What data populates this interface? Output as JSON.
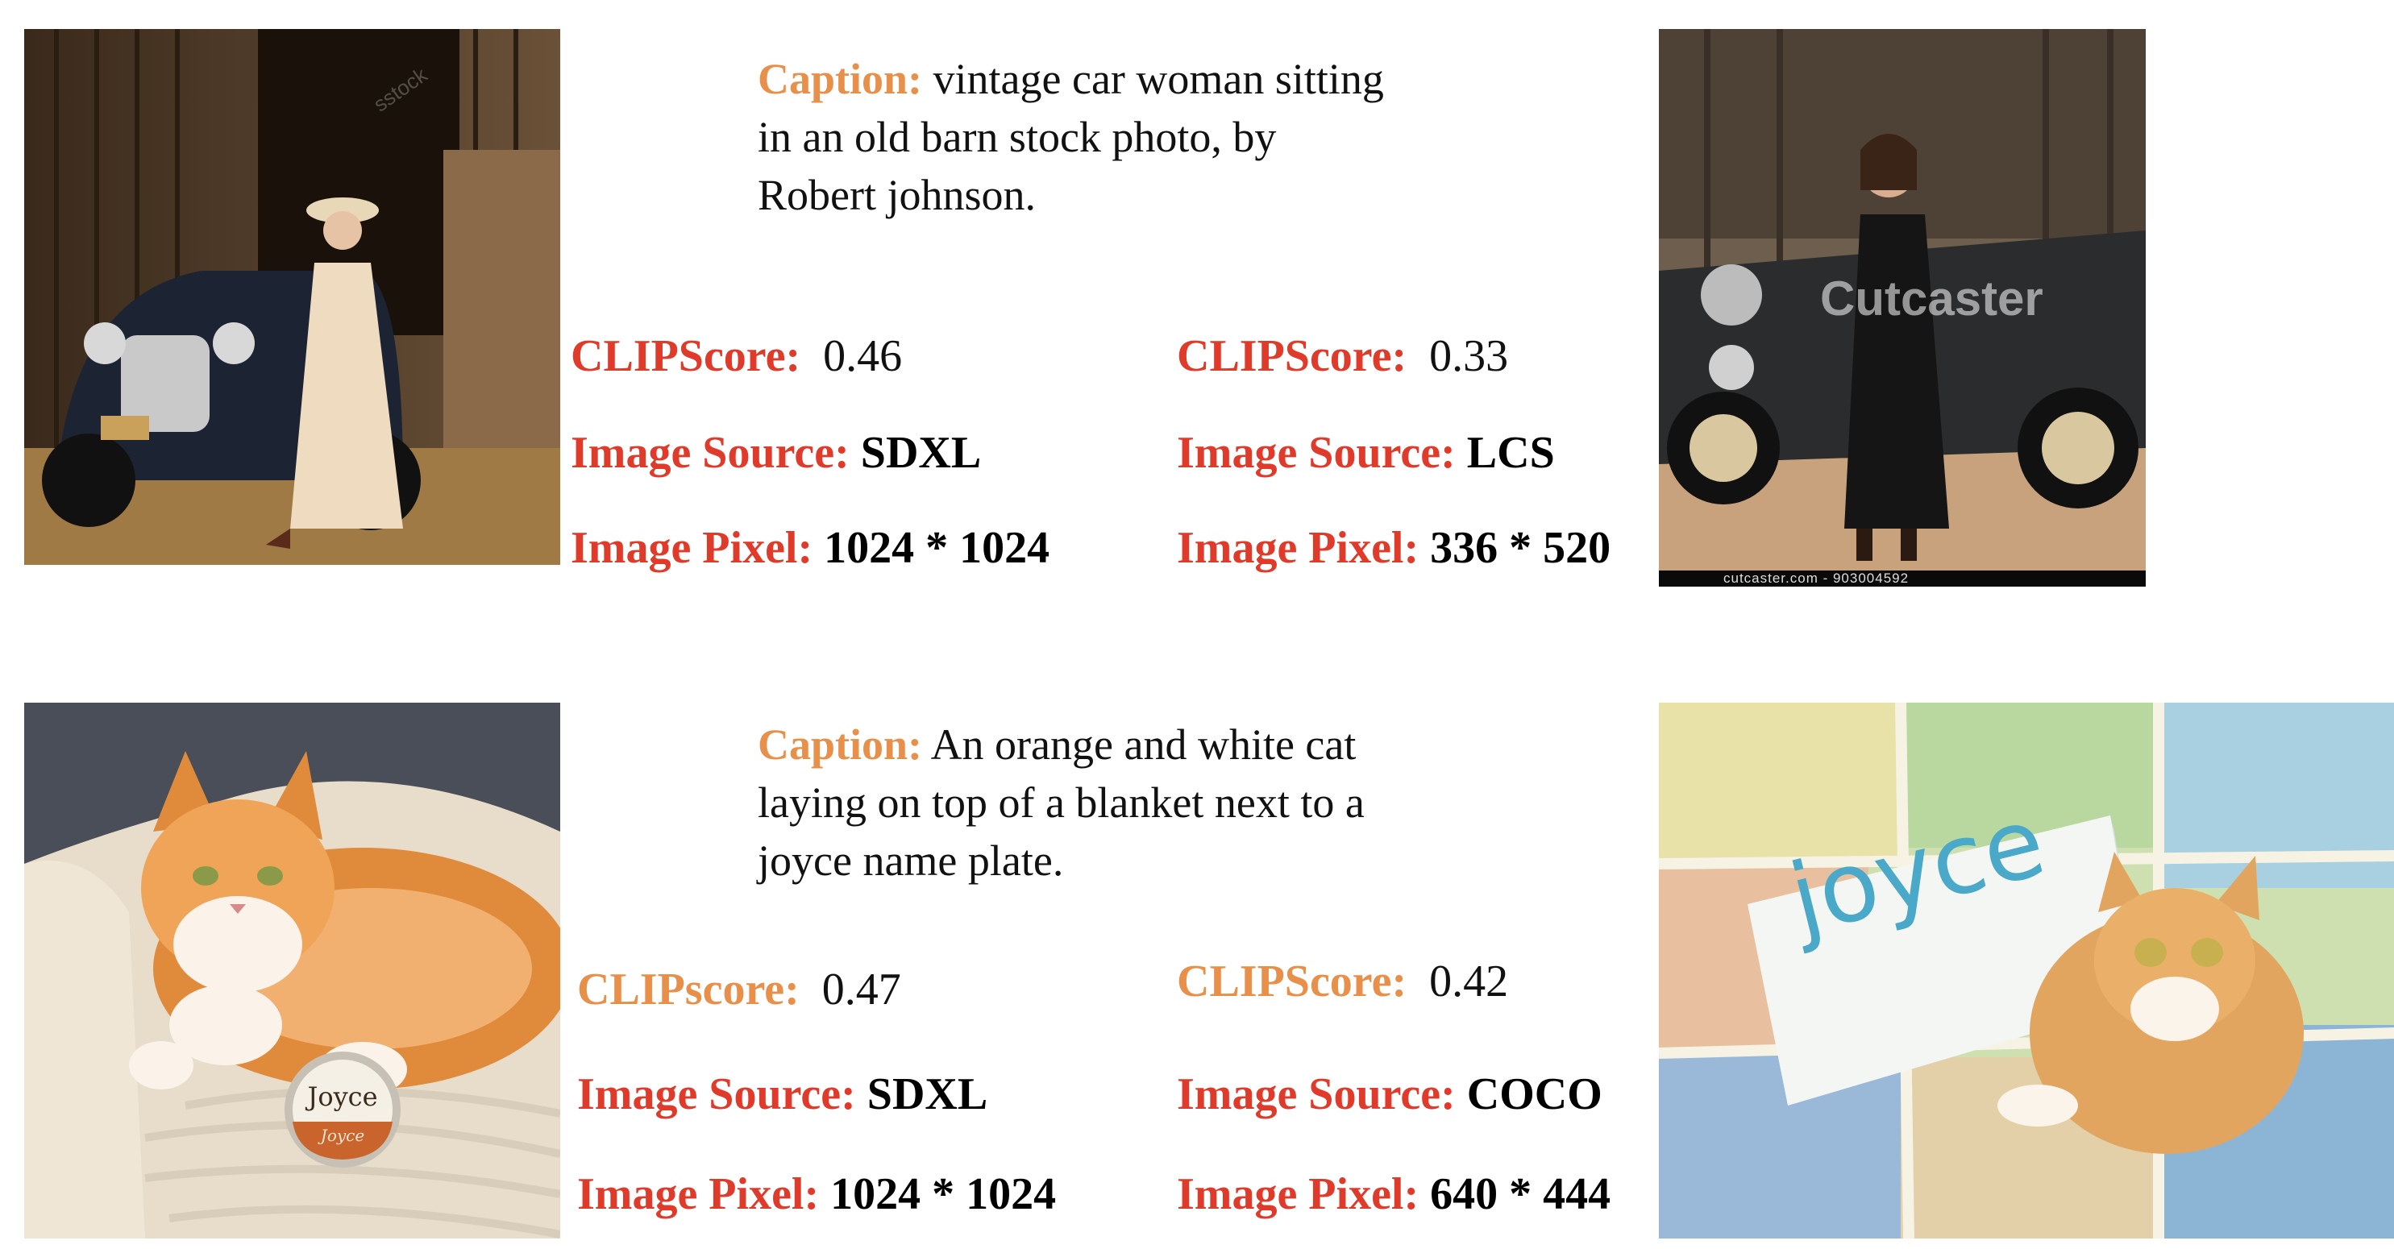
{
  "colors": {
    "label_red": "#E03A2B",
    "label_orange": "#E8904A",
    "text": "#111111"
  },
  "rows": [
    {
      "caption_label": "Caption:",
      "caption_lines": [
        "vintage car woman sitting",
        "in an old barn stock photo, by",
        "Robert johnson."
      ],
      "left": {
        "clip_label": "CLIPScore:",
        "clip_value": "0.46",
        "source_label": "Image Source:",
        "source_value": "SDXL",
        "pixel_label": "Image Pixel:",
        "pixel_value": "1024 * 1024"
      },
      "right": {
        "clip_label": "CLIPScore:",
        "clip_value": "0.33",
        "source_label": "Image Source:",
        "source_value": "LCS",
        "pixel_label": "Image Pixel:",
        "pixel_value": "336 * 520"
      },
      "left_image_text": "sstock",
      "right_image_watermark": "Cutcaster",
      "right_image_footer": "cutcaster.com - 903004592"
    },
    {
      "caption_label": "Caption:",
      "caption_lines": [
        "An orange and white cat",
        "laying on top of a blanket next to a",
        "joyce name plate."
      ],
      "left": {
        "clip_label": "CLIPscore:",
        "clip_value": "0.47",
        "source_label": "Image Source:",
        "source_value": "SDXL",
        "pixel_label": "Image Pixel:",
        "pixel_value": "1024 * 1024"
      },
      "right": {
        "clip_label": "CLIPScore:",
        "clip_value": "0.42",
        "source_label": "Image Source:",
        "source_value": "COCO",
        "pixel_label": "Image Pixel:",
        "pixel_value": "640 * 444"
      },
      "left_image_plate_top": "Joyce",
      "left_image_plate_bottom": "Joyce",
      "right_image_box_text": "joyce"
    }
  ]
}
